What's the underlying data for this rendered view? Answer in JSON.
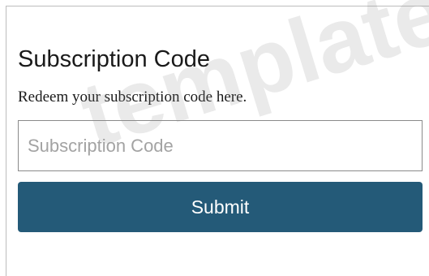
{
  "form": {
    "title": "Subscription Code",
    "description": "Redeem your subscription code here.",
    "code_input": {
      "value": "",
      "placeholder": "Subscription Code"
    },
    "submit_label": "Submit"
  },
  "watermark": {
    "text": "template"
  },
  "colors": {
    "button_background": "#245a78",
    "button_text": "#ffffff",
    "input_border": "#8a8a8a",
    "placeholder": "#a3a3a3"
  }
}
